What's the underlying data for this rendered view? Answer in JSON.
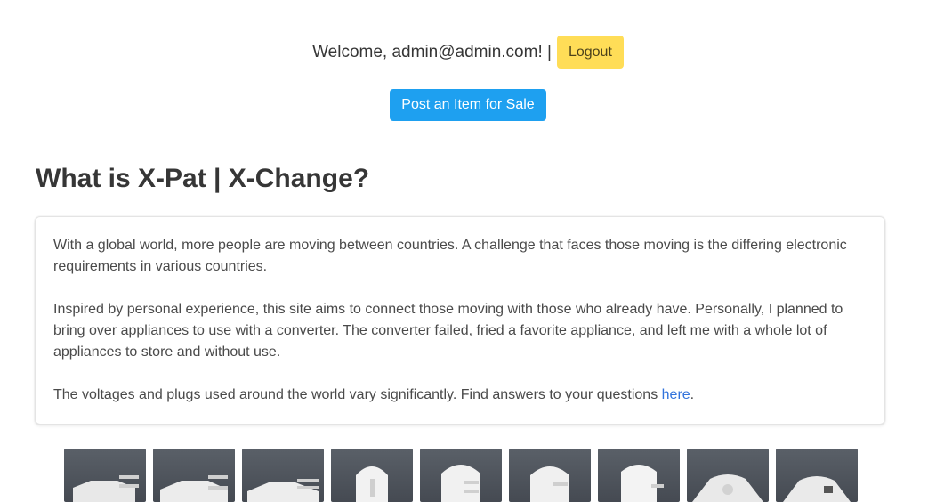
{
  "header": {
    "welcome_text": "Welcome, admin@admin.com! |",
    "logout_label": "Logout",
    "post_item_label": "Post an Item for Sale"
  },
  "main": {
    "title": "What is X-Pat | X-Change?",
    "paragraphs": [
      "With a global world, more people are moving between countries. A challenge that faces those moving is the differing electronic requirements in various countries.",
      "Inspired by personal experience, this site aims to connect those moving with those who already have. Personally, I planned to bring over appliances to use with a converter. The converter failed, fried a favorite appliance, and left me with a whole lot of appliances to store and without use."
    ],
    "voltage_text": "The voltages and plugs used around the world vary significantly. Find answers to your questions ",
    "voltage_link": "here",
    "voltage_end": "."
  },
  "plugs": [
    {
      "icon": "plug-type-a-icon"
    },
    {
      "icon": "plug-type-b-icon"
    },
    {
      "icon": "plug-type-c-icon"
    },
    {
      "icon": "plug-type-d-icon"
    },
    {
      "icon": "plug-type-e-icon"
    },
    {
      "icon": "plug-type-f-icon"
    },
    {
      "icon": "plug-type-g-icon"
    },
    {
      "icon": "plug-type-h-icon"
    },
    {
      "icon": "plug-type-i-icon"
    }
  ],
  "colors": {
    "logout_bg": "#ffdd57",
    "post_bg": "#1ea0f0",
    "link": "#3273dc",
    "thumb_bg": "#4f555d"
  }
}
